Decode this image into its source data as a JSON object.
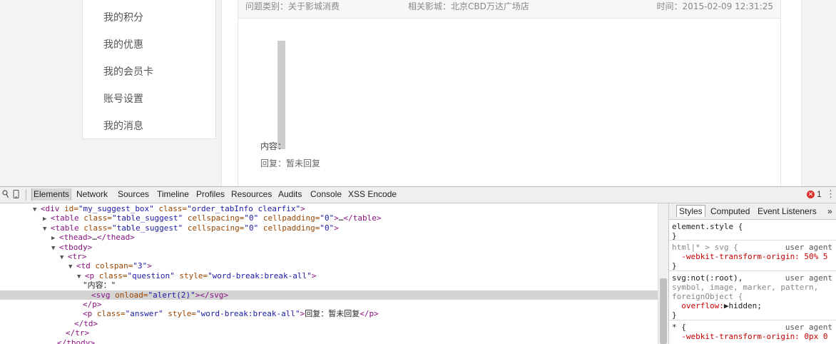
{
  "side_menu": {
    "items": [
      {
        "label": "我的积分"
      },
      {
        "label": "我的优惠"
      },
      {
        "label": "我的会员卡"
      },
      {
        "label": "账号设置"
      },
      {
        "label": "我的消息"
      }
    ]
  },
  "suggest": {
    "category": "问题类别：关于影城消费",
    "cinema": "相关影城：北京CBD万达广场店",
    "time": "时间：2015-02-09 12:31:25",
    "content_label": "内容：",
    "answer": "回复：暂未回复"
  },
  "devtools": {
    "tabs": [
      "Elements",
      "Network",
      "Sources",
      "Timeline",
      "Profiles",
      "Resources",
      "Audits",
      "Console",
      "XSS Encode"
    ],
    "active_tab": "Elements",
    "error_count": "1",
    "dom_lines": [
      {
        "tri": "▼",
        "parts": [
          [
            "tag",
            "<div "
          ],
          [
            "an",
            "id="
          ],
          [
            "av",
            "\"my_suggest_box\""
          ],
          [
            "an",
            " class="
          ],
          [
            "av",
            "\"order_tabInfo clearfix\""
          ],
          [
            "tag",
            ">"
          ]
        ]
      },
      {
        "tri": "▶",
        "parts": [
          [
            "tag",
            "<table "
          ],
          [
            "an",
            "class="
          ],
          [
            "av",
            "\"table_suggest\""
          ],
          [
            "an",
            " cellspacing="
          ],
          [
            "av",
            "\"0\""
          ],
          [
            "an",
            " cellpadding="
          ],
          [
            "av",
            "\"0\""
          ],
          [
            "tag",
            ">"
          ],
          [
            "tx",
            "…"
          ],
          [
            "tag",
            "</table>"
          ]
        ]
      },
      {
        "tri": "▼",
        "parts": [
          [
            "tag",
            "<table "
          ],
          [
            "an",
            "class="
          ],
          [
            "av",
            "\"table_suggest\""
          ],
          [
            "an",
            " cellspacing="
          ],
          [
            "av",
            "\"0\""
          ],
          [
            "an",
            " cellpadding="
          ],
          [
            "av",
            "\"0\""
          ],
          [
            "tag",
            ">"
          ]
        ]
      },
      {
        "tri": "▶",
        "parts": [
          [
            "tag",
            "<thead>"
          ],
          [
            "tx",
            "…"
          ],
          [
            "tag",
            "</thead>"
          ]
        ]
      },
      {
        "tri": "▼",
        "parts": [
          [
            "tag",
            "<tbody>"
          ]
        ]
      },
      {
        "tri": "▼",
        "parts": [
          [
            "tag",
            "<tr>"
          ]
        ]
      },
      {
        "tri": "▼",
        "parts": [
          [
            "tag",
            "<td "
          ],
          [
            "an",
            "colspan="
          ],
          [
            "av",
            "\"3\""
          ],
          [
            "tag",
            ">"
          ]
        ]
      },
      {
        "tri": "▼",
        "parts": [
          [
            "tag",
            "<p "
          ],
          [
            "an",
            "class="
          ],
          [
            "av",
            "\"question\""
          ],
          [
            "an",
            " style="
          ],
          [
            "av",
            "\"word-break:break-all\""
          ],
          [
            "tag",
            ">"
          ]
        ]
      },
      {
        "tri": "",
        "parts": [
          [
            "tx",
            "\"内容：\""
          ]
        ]
      },
      {
        "tri": "",
        "parts": [
          [
            "tag",
            "<svg "
          ],
          [
            "an",
            "onload="
          ],
          [
            "av",
            "\"alert(2)\""
          ],
          [
            "tag",
            "></svg>"
          ]
        ]
      },
      {
        "tri": "",
        "parts": [
          [
            "tag",
            "</p>"
          ]
        ]
      },
      {
        "tri": "",
        "parts": [
          [
            "tag",
            "<p "
          ],
          [
            "an",
            "class="
          ],
          [
            "av",
            "\"answer\""
          ],
          [
            "an",
            " style="
          ],
          [
            "av",
            "\"word-break:break-all\""
          ],
          [
            "tag",
            ">"
          ],
          [
            "tx",
            "回复：暂未回复"
          ],
          [
            "tag",
            "</p>"
          ]
        ]
      },
      {
        "tri": "",
        "parts": [
          [
            "tag",
            "</td>"
          ]
        ]
      },
      {
        "tri": "",
        "parts": [
          [
            "tag",
            "</tr>"
          ]
        ]
      },
      {
        "tri": "",
        "parts": [
          [
            "tag",
            "</tbody>"
          ]
        ]
      }
    ],
    "styles_tabs": [
      "Styles",
      "Computed",
      "Event Listeners"
    ],
    "styles_more": "»",
    "styles_lines": [
      {
        "cls": "",
        "text": "element.style {",
        "ua": ""
      },
      {
        "cls": "",
        "text": "}",
        "ua": ""
      },
      {
        "cls": "gray",
        "text": "html|* > svg {",
        "ua": "user agent"
      },
      {
        "cls": "prop",
        "text": "  -webkit-transform-origin: 50% 5",
        "ua": ""
      },
      {
        "cls": "",
        "text": "}",
        "ua": ""
      },
      {
        "cls": "",
        "text": "svg:not(:root),",
        "ua": "user agent"
      },
      {
        "cls": "gray",
        "text": "symbol, image, marker, pattern,",
        "ua": ""
      },
      {
        "cls": "gray",
        "text": "foreignObject {",
        "ua": ""
      },
      {
        "cls": "prop2",
        "text": "  overflow:▶hidden;",
        "ua": ""
      },
      {
        "cls": "",
        "text": "}",
        "ua": ""
      },
      {
        "cls": "",
        "text": "* {",
        "ua": "user agent"
      },
      {
        "cls": "prop",
        "text": "  -webkit-transform-origin: 0px 0",
        "ua": ""
      }
    ]
  }
}
